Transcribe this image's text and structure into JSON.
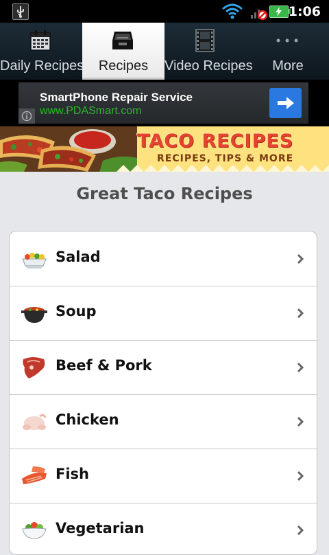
{
  "status_bar": {
    "time": "1:06"
  },
  "tabs": [
    {
      "label": "Daily Recipes",
      "icon": "calendar-icon"
    },
    {
      "label": "Recipes",
      "icon": "inbox-tray-icon"
    },
    {
      "label": "Video Recipes",
      "icon": "film-icon"
    },
    {
      "label": "More",
      "icon": "more-dots-icon"
    }
  ],
  "ad": {
    "title": "SmartPhone Repair Service",
    "url": "www.PDASmart.com"
  },
  "banner": {
    "title": "TACO RECIPES",
    "subtitle": "RECIPES, TIPS & MORE"
  },
  "heading": "Great Taco Recipes",
  "categories": [
    {
      "label": "Salad",
      "icon": "salad-icon"
    },
    {
      "label": "Soup",
      "icon": "soup-pot-icon"
    },
    {
      "label": "Beef & Pork",
      "icon": "steak-icon"
    },
    {
      "label": "Chicken",
      "icon": "chicken-icon"
    },
    {
      "label": "Fish",
      "icon": "fish-fillet-icon"
    },
    {
      "label": "Vegetarian",
      "icon": "vegetarian-bowl-icon"
    }
  ]
}
